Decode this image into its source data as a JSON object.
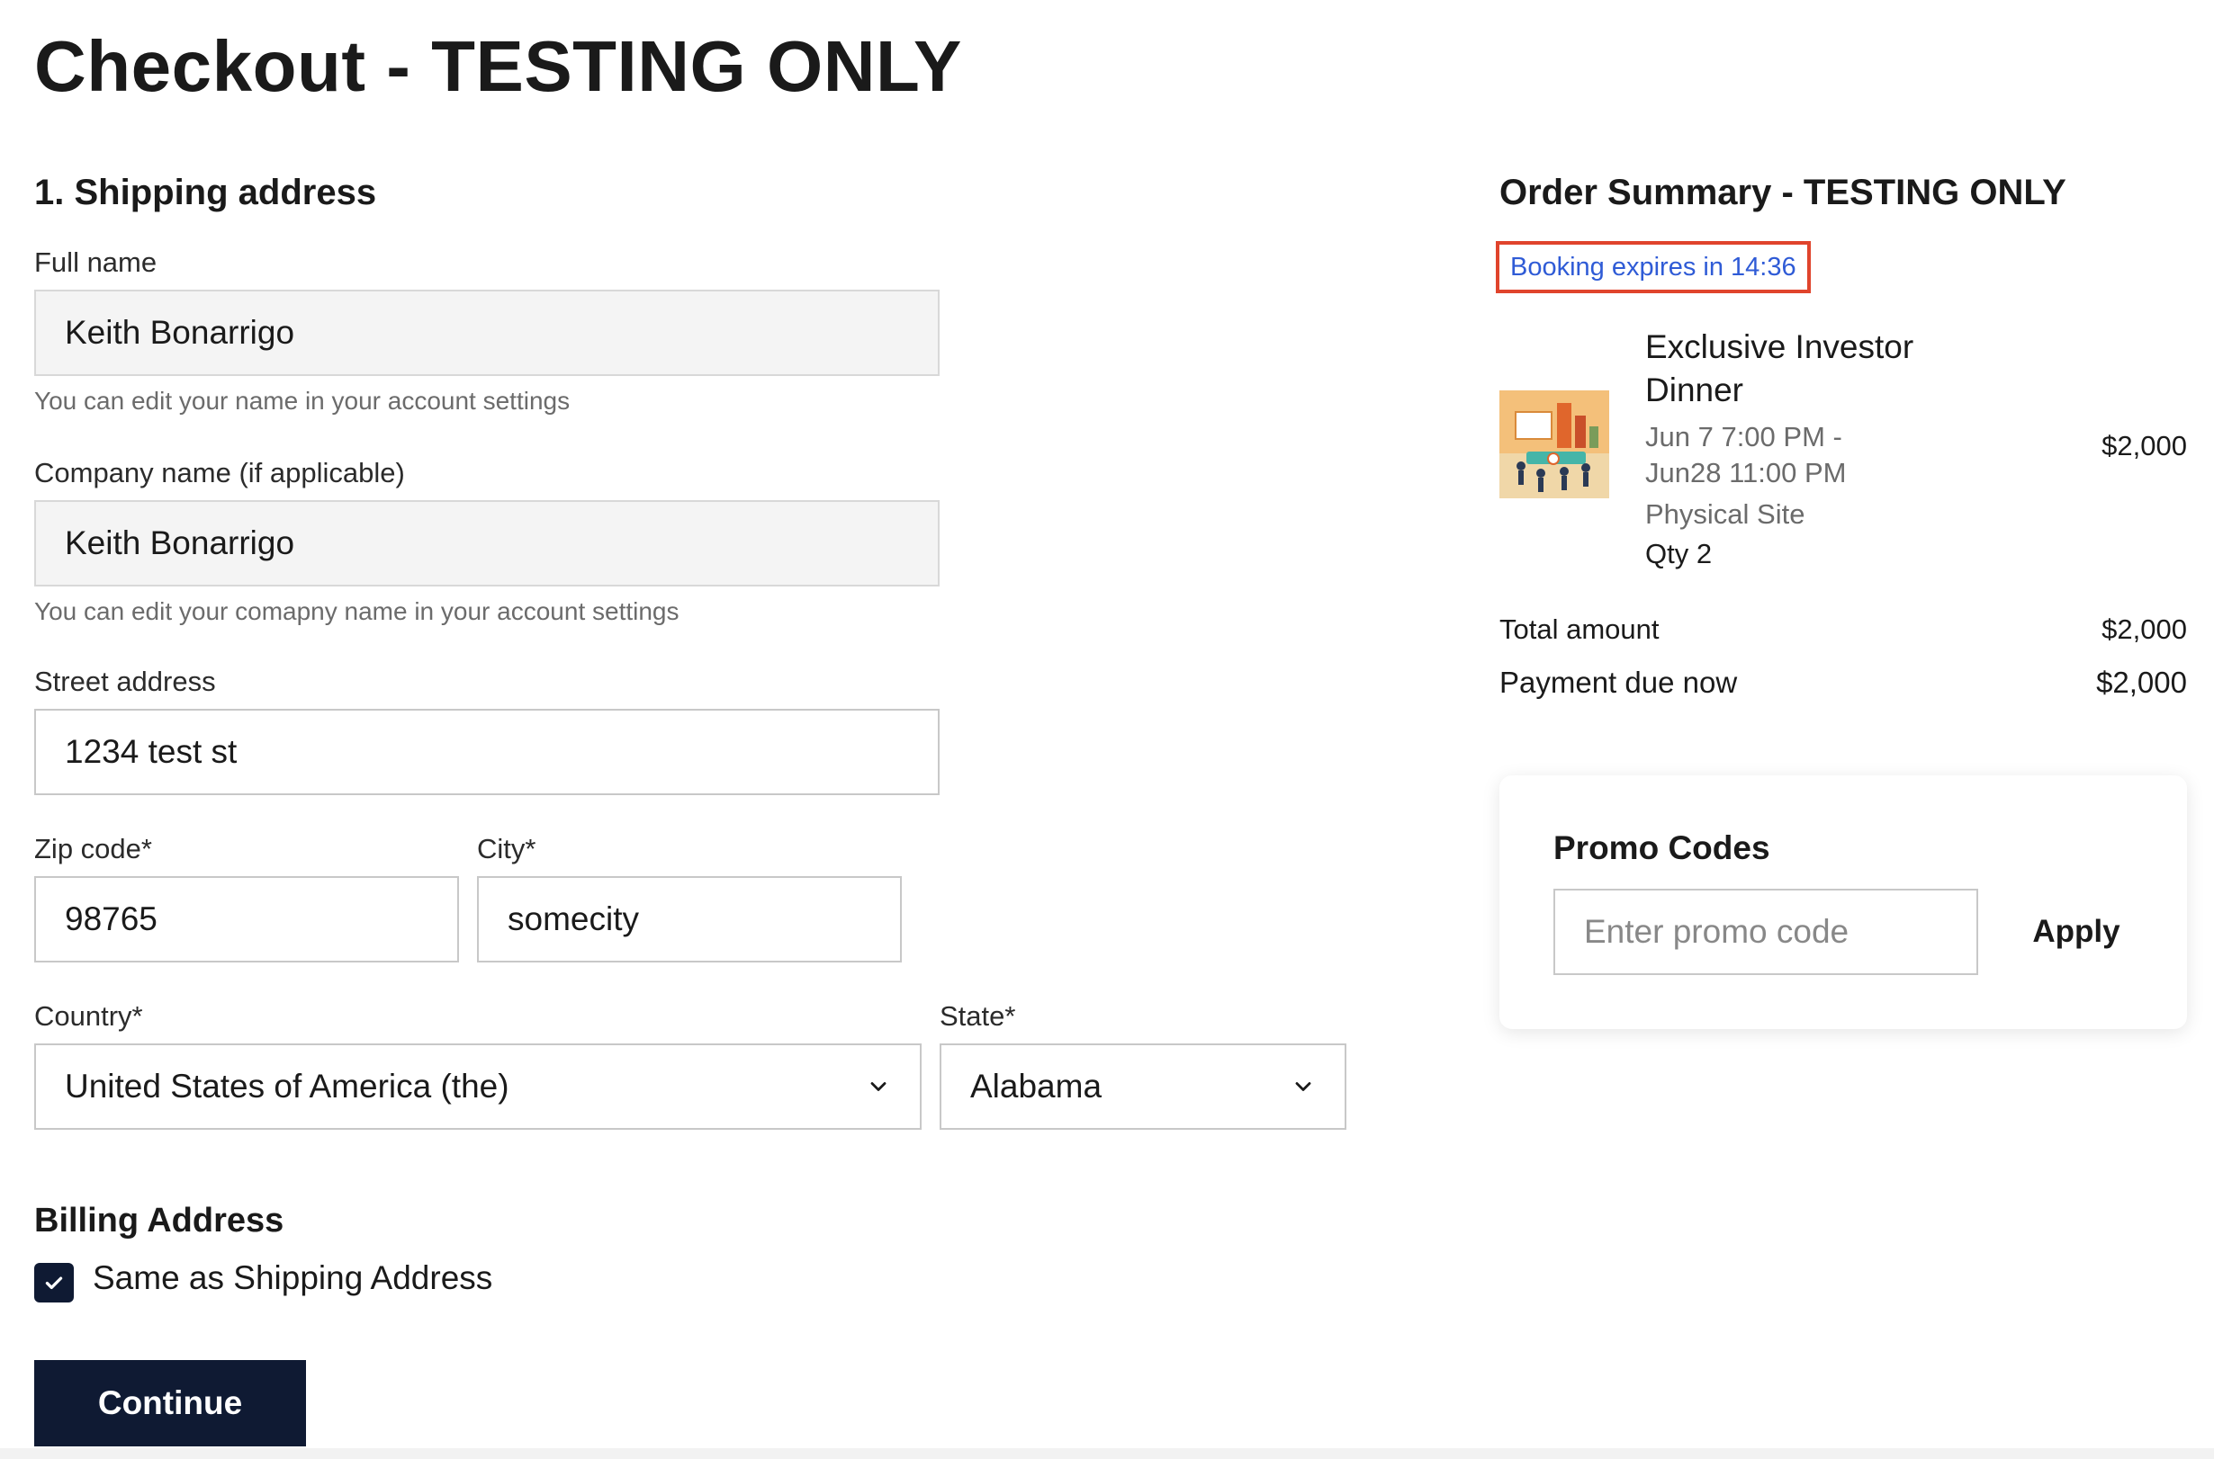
{
  "page": {
    "title": "Checkout - TESTING ONLY"
  },
  "shipping": {
    "heading": "1. Shipping address",
    "full_name": {
      "label": "Full name",
      "value": "Keith Bonarrigo",
      "hint": "You can edit your name in your account settings"
    },
    "company": {
      "label": "Company name (if applicable)",
      "value": "Keith Bonarrigo",
      "hint": "You can edit your comapny name in your account settings"
    },
    "street": {
      "label": "Street address",
      "value": "1234 test st"
    },
    "zip": {
      "label": "Zip code*",
      "value": "98765"
    },
    "city": {
      "label": "City*",
      "value": "somecity"
    },
    "country": {
      "label": "Country*",
      "value": "United States of America (the)"
    },
    "state": {
      "label": "State*",
      "value": "Alabama"
    }
  },
  "billing": {
    "heading": "Billing Address",
    "same_as_shipping_label": "Same as Shipping Address",
    "same_as_shipping_checked": true
  },
  "actions": {
    "continue_label": "Continue"
  },
  "summary": {
    "heading": "Order Summary - TESTING ONLY",
    "timer": "Booking expires in 14:36",
    "item": {
      "title": "Exclusive Investor Dinner",
      "date_line1": "Jun 7 7:00 PM -",
      "date_line2": "Jun28 11:00 PM",
      "location": "Physical Site",
      "qty": "Qty 2",
      "price": "$2,000"
    },
    "total_label": "Total amount",
    "total_value": "$2,000",
    "due_label": "Payment due now",
    "due_value": "$2,000"
  },
  "promo": {
    "heading": "Promo Codes",
    "placeholder": "Enter promo code",
    "apply_label": "Apply"
  },
  "colors": {
    "primary": "#0f1a33",
    "timer_text": "#2f5bd6",
    "timer_border": "#e0442c"
  }
}
